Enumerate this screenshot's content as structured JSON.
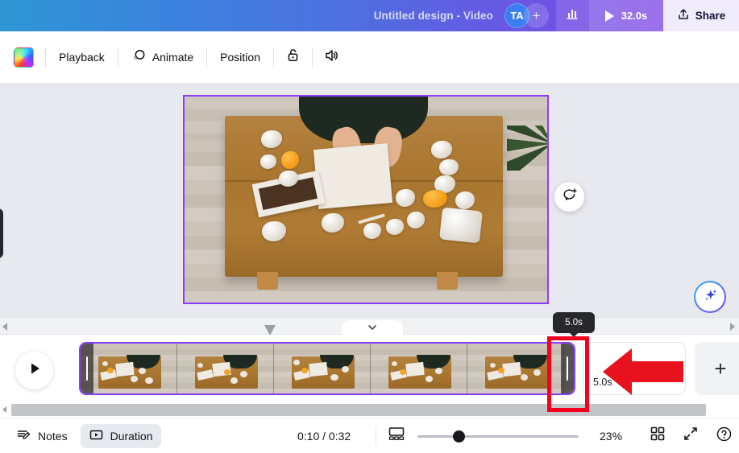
{
  "topbar": {
    "doc_title": "Untitled design - Video",
    "avatar_initials": "TA",
    "add_collaborator_label": "+",
    "stats_icon": "bar-chart-icon",
    "play_duration": "32.0s",
    "share_label": "Share"
  },
  "toolbar": {
    "color_swatch": "rainbow-color-swatch",
    "playback_label": "Playback",
    "animate_label": "Animate",
    "position_label": "Position",
    "lock_icon": "unlock-icon",
    "volume_icon": "speaker-icon"
  },
  "canvas": {
    "comment_icon": "add-comment-icon",
    "magic_icon": "magic-sparkle-icon",
    "selection_color": "#8b3dfc",
    "scene_description": "Overhead view of person at wooden table with crumpled papers"
  },
  "timeline": {
    "play_icon": "play-icon",
    "clip_left_handle": "trim-handle-left",
    "clip_right_handle": "trim-handle-right",
    "duration_label": "5.0s",
    "add_page_label": "+",
    "collapse_icon": "chevron-down-icon",
    "tooltip_text": "5.0s"
  },
  "bottombar": {
    "notes_label": "Notes",
    "duration_label": "Duration",
    "time_display": "0:10 / 0:32",
    "zoom_percent": "23%",
    "zoom_value": 23,
    "grid_icon": "grid-view-icon",
    "expand_icon": "fullscreen-icon",
    "help_icon": "help-icon",
    "pages_icon": "pages-view-icon"
  },
  "annotations": {
    "highlight_color": "#f2001e",
    "arrow_direction": "left",
    "arrow_color": "#e8121f"
  }
}
